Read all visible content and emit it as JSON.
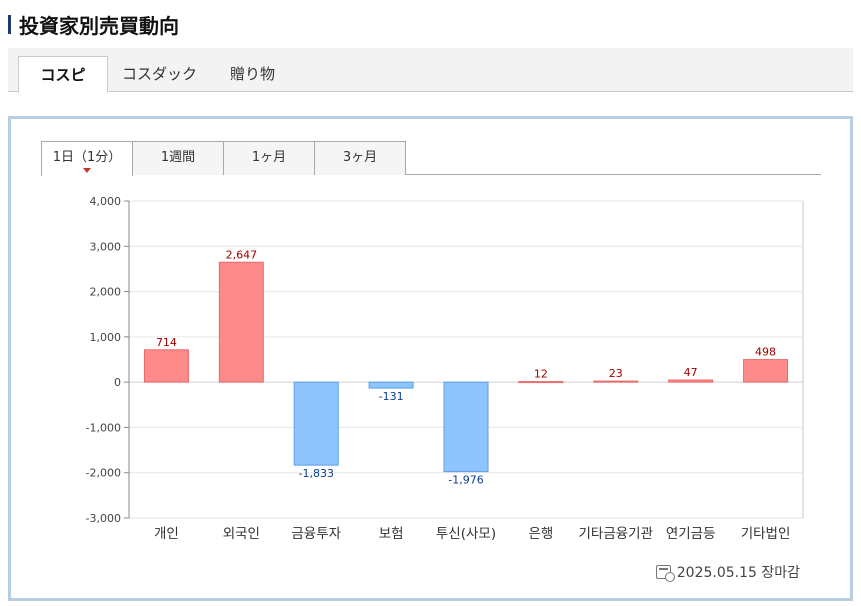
{
  "page": {
    "title": "投資家別売買動向"
  },
  "main_tabs": [
    {
      "label": "コスピ",
      "active": true
    },
    {
      "label": "コスダック",
      "active": false
    },
    {
      "label": "贈り物",
      "active": false
    }
  ],
  "sub_tabs": [
    {
      "label": "1日（1分）",
      "active": true
    },
    {
      "label": "1週間",
      "active": false
    },
    {
      "label": "1ヶ月",
      "active": false
    },
    {
      "label": "3ヶ月",
      "active": false
    }
  ],
  "footer": {
    "date_label": "2025.05.15 장마감",
    "icon": "calendar-clock-icon"
  },
  "chart_data": {
    "type": "bar",
    "categories": [
      "개인",
      "외국인",
      "금융투자",
      "보험",
      "투신(사모)",
      "은행",
      "기타금융",
      "기관",
      "연기금등",
      "기타법인"
    ],
    "category_labels_display": [
      "개인",
      "외국인",
      "금융투자",
      "보험",
      "투신(사모)",
      "은행",
      "기타금융기관",
      "연기금등",
      "기타법인"
    ],
    "values": [
      714,
      2647,
      -1833,
      -131,
      -1976,
      12,
      23,
      47,
      498
    ],
    "value_labels": [
      "714",
      "2,647",
      "-1,833",
      "-131",
      "-1,976",
      "12",
      "23",
      "47",
      "498"
    ],
    "ylim": [
      -3000,
      4000
    ],
    "yticks": [
      4000,
      3000,
      2000,
      1000,
      0,
      -1000,
      -2000,
      -3000
    ],
    "ytick_labels": [
      "4,000",
      "3,000",
      "2,000",
      "1,000",
      "0",
      "-1,000",
      "-2,000",
      "-3,000"
    ],
    "grid": true,
    "colors": {
      "positive_fill": "#ff8a8a",
      "positive_stroke": "#e86a6a",
      "negative_fill": "#8ec5ff",
      "negative_stroke": "#5b9ee6",
      "positive_label": "#a30000",
      "negative_label": "#0b3d91"
    }
  }
}
